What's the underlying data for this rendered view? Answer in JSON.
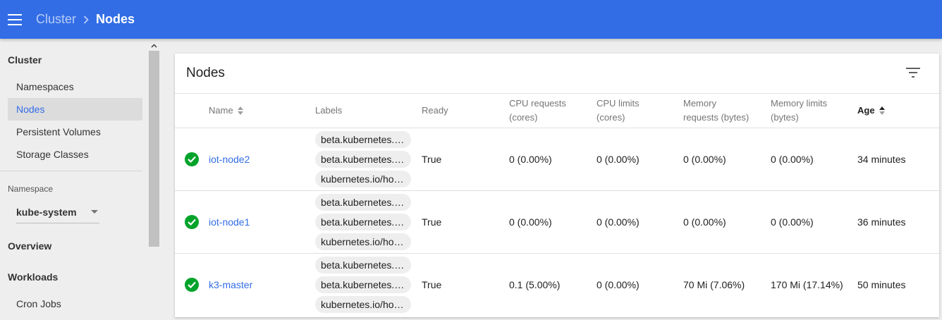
{
  "topbar": {
    "breadcrumb_parent": "Cluster",
    "breadcrumb_current": "Nodes"
  },
  "sidebar": {
    "cluster_heading": "Cluster",
    "cluster_items": [
      {
        "label": "Namespaces",
        "active": false
      },
      {
        "label": "Nodes",
        "active": true
      },
      {
        "label": "Persistent Volumes",
        "active": false
      },
      {
        "label": "Storage Classes",
        "active": false
      }
    ],
    "namespace_label": "Namespace",
    "namespace_value": "kube-system",
    "overview_heading": "Overview",
    "workloads_heading": "Workloads",
    "workloads_items": [
      {
        "label": "Cron Jobs"
      }
    ]
  },
  "card": {
    "title": "Nodes",
    "columns": {
      "name": "Name",
      "labels": "Labels",
      "ready": "Ready",
      "cpu_requests_1": "CPU requests",
      "cpu_requests_2": "(cores)",
      "cpu_limits_1": "CPU limits",
      "cpu_limits_2": "(cores)",
      "mem_requests_1": "Memory",
      "mem_requests_2": "requests (bytes)",
      "mem_limits_1": "Memory limits",
      "mem_limits_2": "(bytes)",
      "age": "Age"
    },
    "rows": [
      {
        "name": "iot-node2",
        "labels": [
          "beta.kubernetes.io/...",
          "beta.kubernetes.io/...",
          "kubernetes.io/host..."
        ],
        "ready": "True",
        "cpu_requests": "0 (0.00%)",
        "cpu_limits": "0 (0.00%)",
        "mem_requests": "0 (0.00%)",
        "mem_limits": "0 (0.00%)",
        "age": "34 minutes"
      },
      {
        "name": "iot-node1",
        "labels": [
          "beta.kubernetes.io/...",
          "beta.kubernetes.io/...",
          "kubernetes.io/host..."
        ],
        "ready": "True",
        "cpu_requests": "0 (0.00%)",
        "cpu_limits": "0 (0.00%)",
        "mem_requests": "0 (0.00%)",
        "mem_limits": "0 (0.00%)",
        "age": "36 minutes"
      },
      {
        "name": "k3-master",
        "labels": [
          "beta.kubernetes.io/...",
          "beta.kubernetes.io/...",
          "kubernetes.io/host..."
        ],
        "ready": "True",
        "cpu_requests": "0.1 (5.00%)",
        "cpu_limits": "0 (0.00%)",
        "mem_requests": "70 Mi (7.06%)",
        "mem_limits": "170 Mi (17.14%)",
        "age": "50 minutes"
      }
    ]
  },
  "colors": {
    "brand": "#326de6",
    "status_ok": "#00a32a"
  }
}
